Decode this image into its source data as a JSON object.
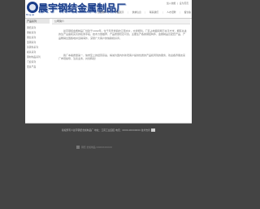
{
  "header": {
    "company_name": "晨宇钢结金属制品厂",
    "logo_sub": "Ming Jie",
    "top_links": [
      "加入收藏",
      "设为首页"
    ],
    "nav": [
      "公司简介",
      "产品展示",
      "供求信息",
      "联系我们",
      "人才招聘",
      "留言版"
    ]
  },
  "sidebar": {
    "title": "产品系列",
    "items": [
      "钢结系列",
      "钢板系列",
      "钢丝系列",
      "型钢系列",
      "铸钢件系列",
      "模具系列",
      "钢材制品系列",
      "门窗系列",
      "更多产品"
    ]
  },
  "content": {
    "title": "公司简介",
    "paragraphs": [
      "晨宇钢结金属制品厂创建于1992年，位于风景秀丽的江南水乡，交通便利。厂区占地面积两万余平方米，拥有先进的生产设备和完善的检测手段，技术力量雄厚，产品质量稳定可靠。主要生产各类钢结构件、金属制品及配套产品，产品畅销全国各地并远销海外，深受广大客户的信赖和好评。",
      "我厂本着质量第一、信誉至上的经营宗旨，竭诚为国内外新老客户提供优质的产品和周到的服务，欢迎各界朋友来厂参观指导，洽谈业务，共创辉煌！"
    ]
  },
  "footer": {
    "text": "版权所有©晨宇钢结金属制品厂 地址：江南工业园区 电话：0000-00000000 技术支持"
  },
  "bottom": {
    "text": "钢结 金属制品 CNXXXXXXXX"
  },
  "colors": {
    "background": "#444444",
    "brand": "#1a3d8a"
  }
}
